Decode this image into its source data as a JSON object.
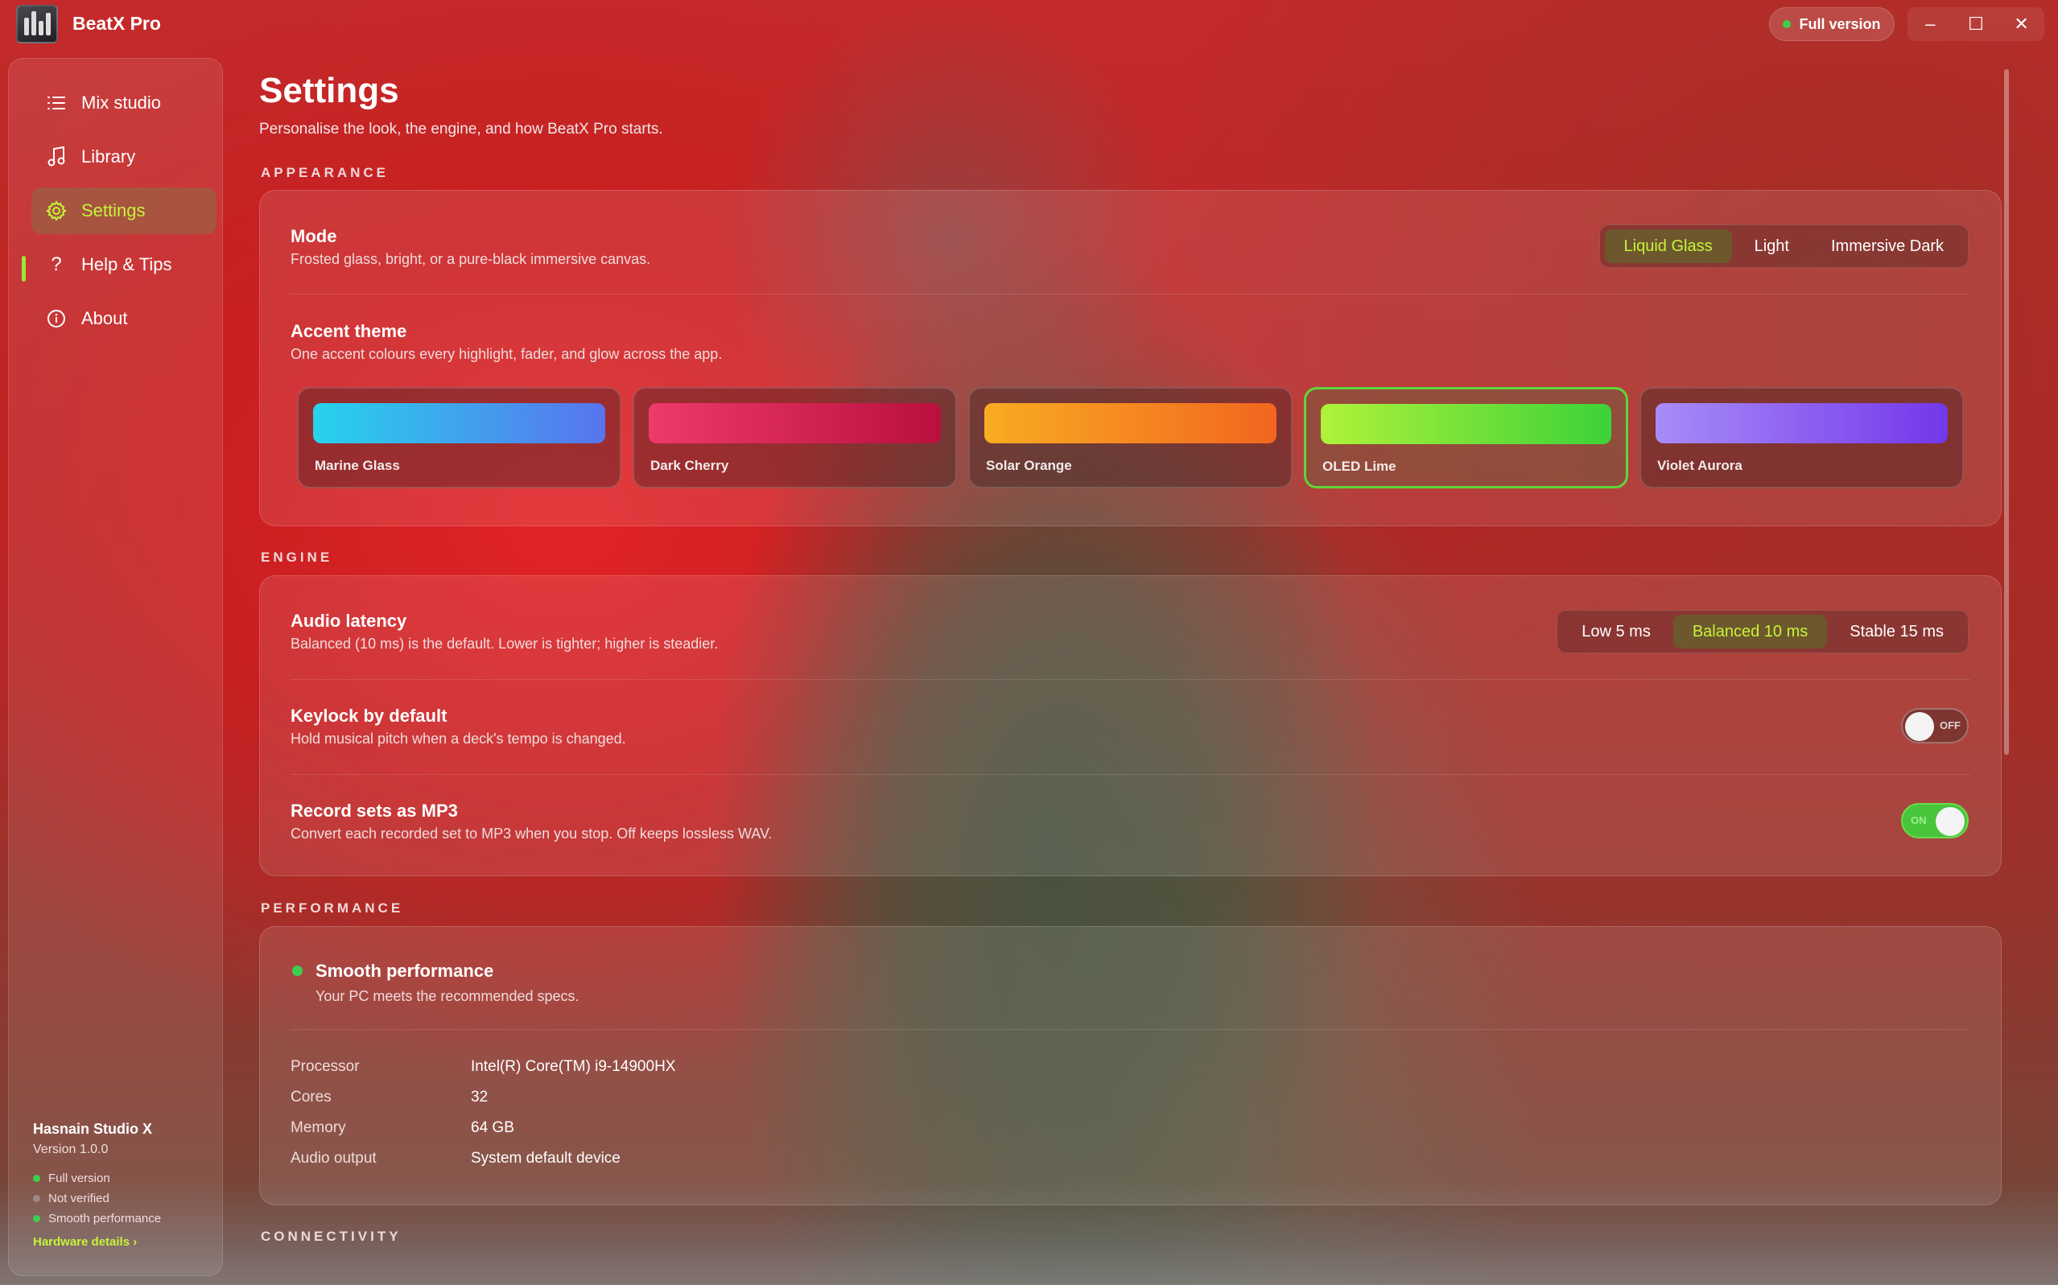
{
  "app": {
    "title": "BeatX Pro",
    "version_badge": "Full version",
    "window_controls": [
      "–",
      "☐",
      "✕"
    ]
  },
  "sidebar": {
    "items": [
      {
        "label": "Mix studio",
        "icon": "list-icon",
        "active": false
      },
      {
        "label": "Library",
        "icon": "music-note-icon",
        "active": false
      },
      {
        "label": "Settings",
        "icon": "gear-icon",
        "active": true
      },
      {
        "label": "Help & Tips",
        "icon": "question-icon",
        "active": false
      },
      {
        "label": "About",
        "icon": "info-icon",
        "active": false
      }
    ],
    "footer": {
      "org": "Hasnain Studio X",
      "version": "Version 1.0.0",
      "statuses": [
        {
          "label": "Full version",
          "color": "#3ccf4e"
        },
        {
          "label": "Not verified",
          "color": "#9a8a8a"
        },
        {
          "label": "Smooth performance",
          "color": "#3ccf4e"
        }
      ],
      "link": "Hardware details ›"
    }
  },
  "page": {
    "title": "Settings",
    "subtitle": "Personalise the look, the engine, and how BeatX Pro starts."
  },
  "appearance": {
    "section": "APPEARANCE",
    "mode": {
      "title": "Mode",
      "desc": "Frosted glass, bright, or a pure-black immersive canvas.",
      "options": [
        "Liquid Glass",
        "Light",
        "Immersive Dark"
      ],
      "selected": "Liquid Glass"
    },
    "accent": {
      "title": "Accent theme",
      "desc": "One accent colours every highlight, fader, and glow across the app.",
      "themes": [
        {
          "name": "Marine Glass",
          "from": "#27d3ec",
          "to": "#5874ee"
        },
        {
          "name": "Dark Cherry",
          "from": "#ee3a6a",
          "to": "#b9103d"
        },
        {
          "name": "Solar Orange",
          "from": "#f9ac22",
          "to": "#f2651f"
        },
        {
          "name": "OLED Lime",
          "from": "#b0f23a",
          "to": "#3cd238"
        },
        {
          "name": "Violet Aurora",
          "from": "#a88cf8",
          "to": "#7337ea"
        }
      ],
      "selected": "OLED Lime"
    }
  },
  "engine": {
    "section": "ENGINE",
    "latency": {
      "title": "Audio latency",
      "desc": "Balanced (10 ms) is the default. Lower is tighter; higher is steadier.",
      "options": [
        "Low 5 ms",
        "Balanced 10 ms",
        "Stable 15 ms"
      ],
      "selected": "Balanced 10 ms"
    },
    "keylock": {
      "title": "Keylock by default",
      "desc": "Hold musical pitch when a deck's tempo is changed.",
      "state": "OFF"
    },
    "mp3": {
      "title": "Record sets as MP3",
      "desc": "Convert each recorded set to MP3 when you stop. Off keeps lossless WAV.",
      "state": "ON"
    }
  },
  "performance": {
    "section": "PERFORMANCE",
    "status_title": "Smooth performance",
    "status_desc": "Your PC meets the recommended specs.",
    "specs": [
      {
        "key": "Processor",
        "value": "Intel(R) Core(TM) i9-14900HX"
      },
      {
        "key": "Cores",
        "value": "32"
      },
      {
        "key": "Memory",
        "value": "64 GB"
      },
      {
        "key": "Audio output",
        "value": "System default device"
      }
    ]
  },
  "connectivity": {
    "section": "CONNECTIVITY"
  },
  "colors": {
    "accent": "#c6f43a",
    "ok": "#3ccf4e"
  }
}
